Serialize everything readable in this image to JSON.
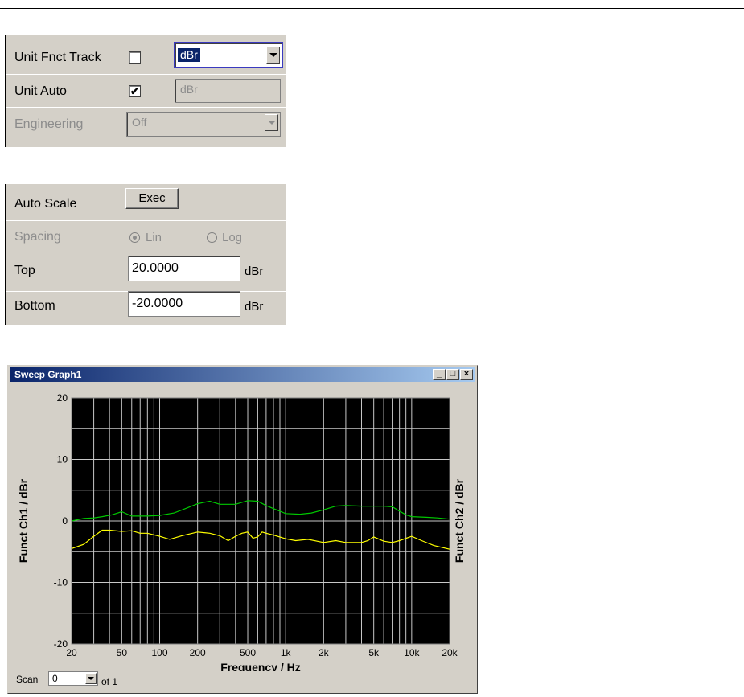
{
  "unit_panel": {
    "unit_fnct_track_label": "Unit Fnct Track",
    "unit_fnct_track_checked": false,
    "unit_fnct_track_value": "dBr",
    "unit_auto_label": "Unit Auto",
    "unit_auto_checked": true,
    "unit_auto_check_glyph": "✔",
    "unit_auto_value": "dBr",
    "engineering_label": "Engineering",
    "engineering_value": "Off"
  },
  "scale_panel": {
    "auto_scale_label": "Auto Scale",
    "exec_label": "Exec",
    "spacing_label": "Spacing",
    "lin_label": "Lin",
    "log_label": "Log",
    "spacing_selected": "Lin",
    "top_label": "Top",
    "top_value": "20.0000",
    "top_unit": "dBr",
    "bottom_label": "Bottom",
    "bottom_value": "-20.0000",
    "bottom_unit": "dBr"
  },
  "graph_window": {
    "title": "Sweep Graph1",
    "minimize_icon": "minimize-icon",
    "maximize_icon": "maximize-icon",
    "close_icon": "close-icon",
    "scan_label": "Scan",
    "scan_value": "0",
    "of_label": "of 1"
  },
  "chart_data": {
    "type": "line",
    "xlabel": "Frequency / Hz",
    "ylabel_left": "Funct Ch1 / dBr",
    "ylabel_right": "Funct Ch2 / dBr",
    "x_scale": "log",
    "xlim": [
      20,
      20000
    ],
    "ylim": [
      -20,
      20
    ],
    "grid": true,
    "background": "#000000",
    "grid_color": "#c8c8c8",
    "x_ticks": [
      {
        "v": 20,
        "label": "20"
      },
      {
        "v": 50,
        "label": "50"
      },
      {
        "v": 100,
        "label": "100"
      },
      {
        "v": 200,
        "label": "200"
      },
      {
        "v": 500,
        "label": "500"
      },
      {
        "v": 1000,
        "label": "1k"
      },
      {
        "v": 2000,
        "label": "2k"
      },
      {
        "v": 5000,
        "label": "5k"
      },
      {
        "v": 10000,
        "label": "10k"
      },
      {
        "v": 20000,
        "label": "20k"
      }
    ],
    "y_ticks": [
      {
        "v": 20,
        "label": "20"
      },
      {
        "v": 10,
        "label": "10"
      },
      {
        "v": 0,
        "label": "0"
      },
      {
        "v": -10,
        "label": "-10"
      },
      {
        "v": -20,
        "label": "-20"
      }
    ],
    "series": [
      {
        "color": "#00c800",
        "x": [
          20,
          25,
          30,
          35,
          42,
          50,
          60,
          80,
          100,
          130,
          160,
          200,
          250,
          300,
          400,
          500,
          600,
          700,
          800,
          1000,
          1300,
          1600,
          2000,
          2500,
          3000,
          4000,
          5000,
          6000,
          7000,
          8000,
          9000,
          10000,
          13000,
          16000,
          20000
        ],
        "y": [
          0.0,
          0.4,
          0.5,
          0.7,
          1.0,
          1.5,
          0.8,
          0.8,
          0.9,
          1.3,
          2.0,
          2.8,
          3.2,
          2.7,
          2.7,
          3.3,
          3.2,
          2.5,
          2.0,
          1.2,
          1.1,
          1.3,
          1.8,
          2.4,
          2.5,
          2.4,
          2.4,
          2.4,
          2.3,
          1.6,
          1.0,
          0.7,
          0.6,
          0.5,
          0.3
        ]
      },
      {
        "color": "#ffff00",
        "x": [
          20,
          25,
          30,
          35,
          40,
          50,
          60,
          70,
          80,
          100,
          120,
          150,
          200,
          250,
          300,
          350,
          400,
          450,
          500,
          550,
          600,
          650,
          700,
          800,
          1000,
          1200,
          1500,
          2000,
          2500,
          3000,
          4000,
          4500,
          5000,
          6000,
          7000,
          8000,
          10000,
          12000,
          15000,
          20000
        ],
        "y": [
          -4.5,
          -3.8,
          -2.5,
          -1.5,
          -1.5,
          -1.7,
          -1.6,
          -2.0,
          -2.0,
          -2.5,
          -3.0,
          -2.4,
          -1.8,
          -2.0,
          -2.4,
          -3.2,
          -2.5,
          -2.0,
          -1.8,
          -2.8,
          -2.6,
          -1.8,
          -2.0,
          -2.3,
          -2.9,
          -3.2,
          -3.0,
          -3.5,
          -3.2,
          -3.5,
          -3.5,
          -3.2,
          -2.6,
          -3.3,
          -3.5,
          -3.2,
          -2.5,
          -3.2,
          -4.0,
          -4.6
        ]
      }
    ]
  }
}
